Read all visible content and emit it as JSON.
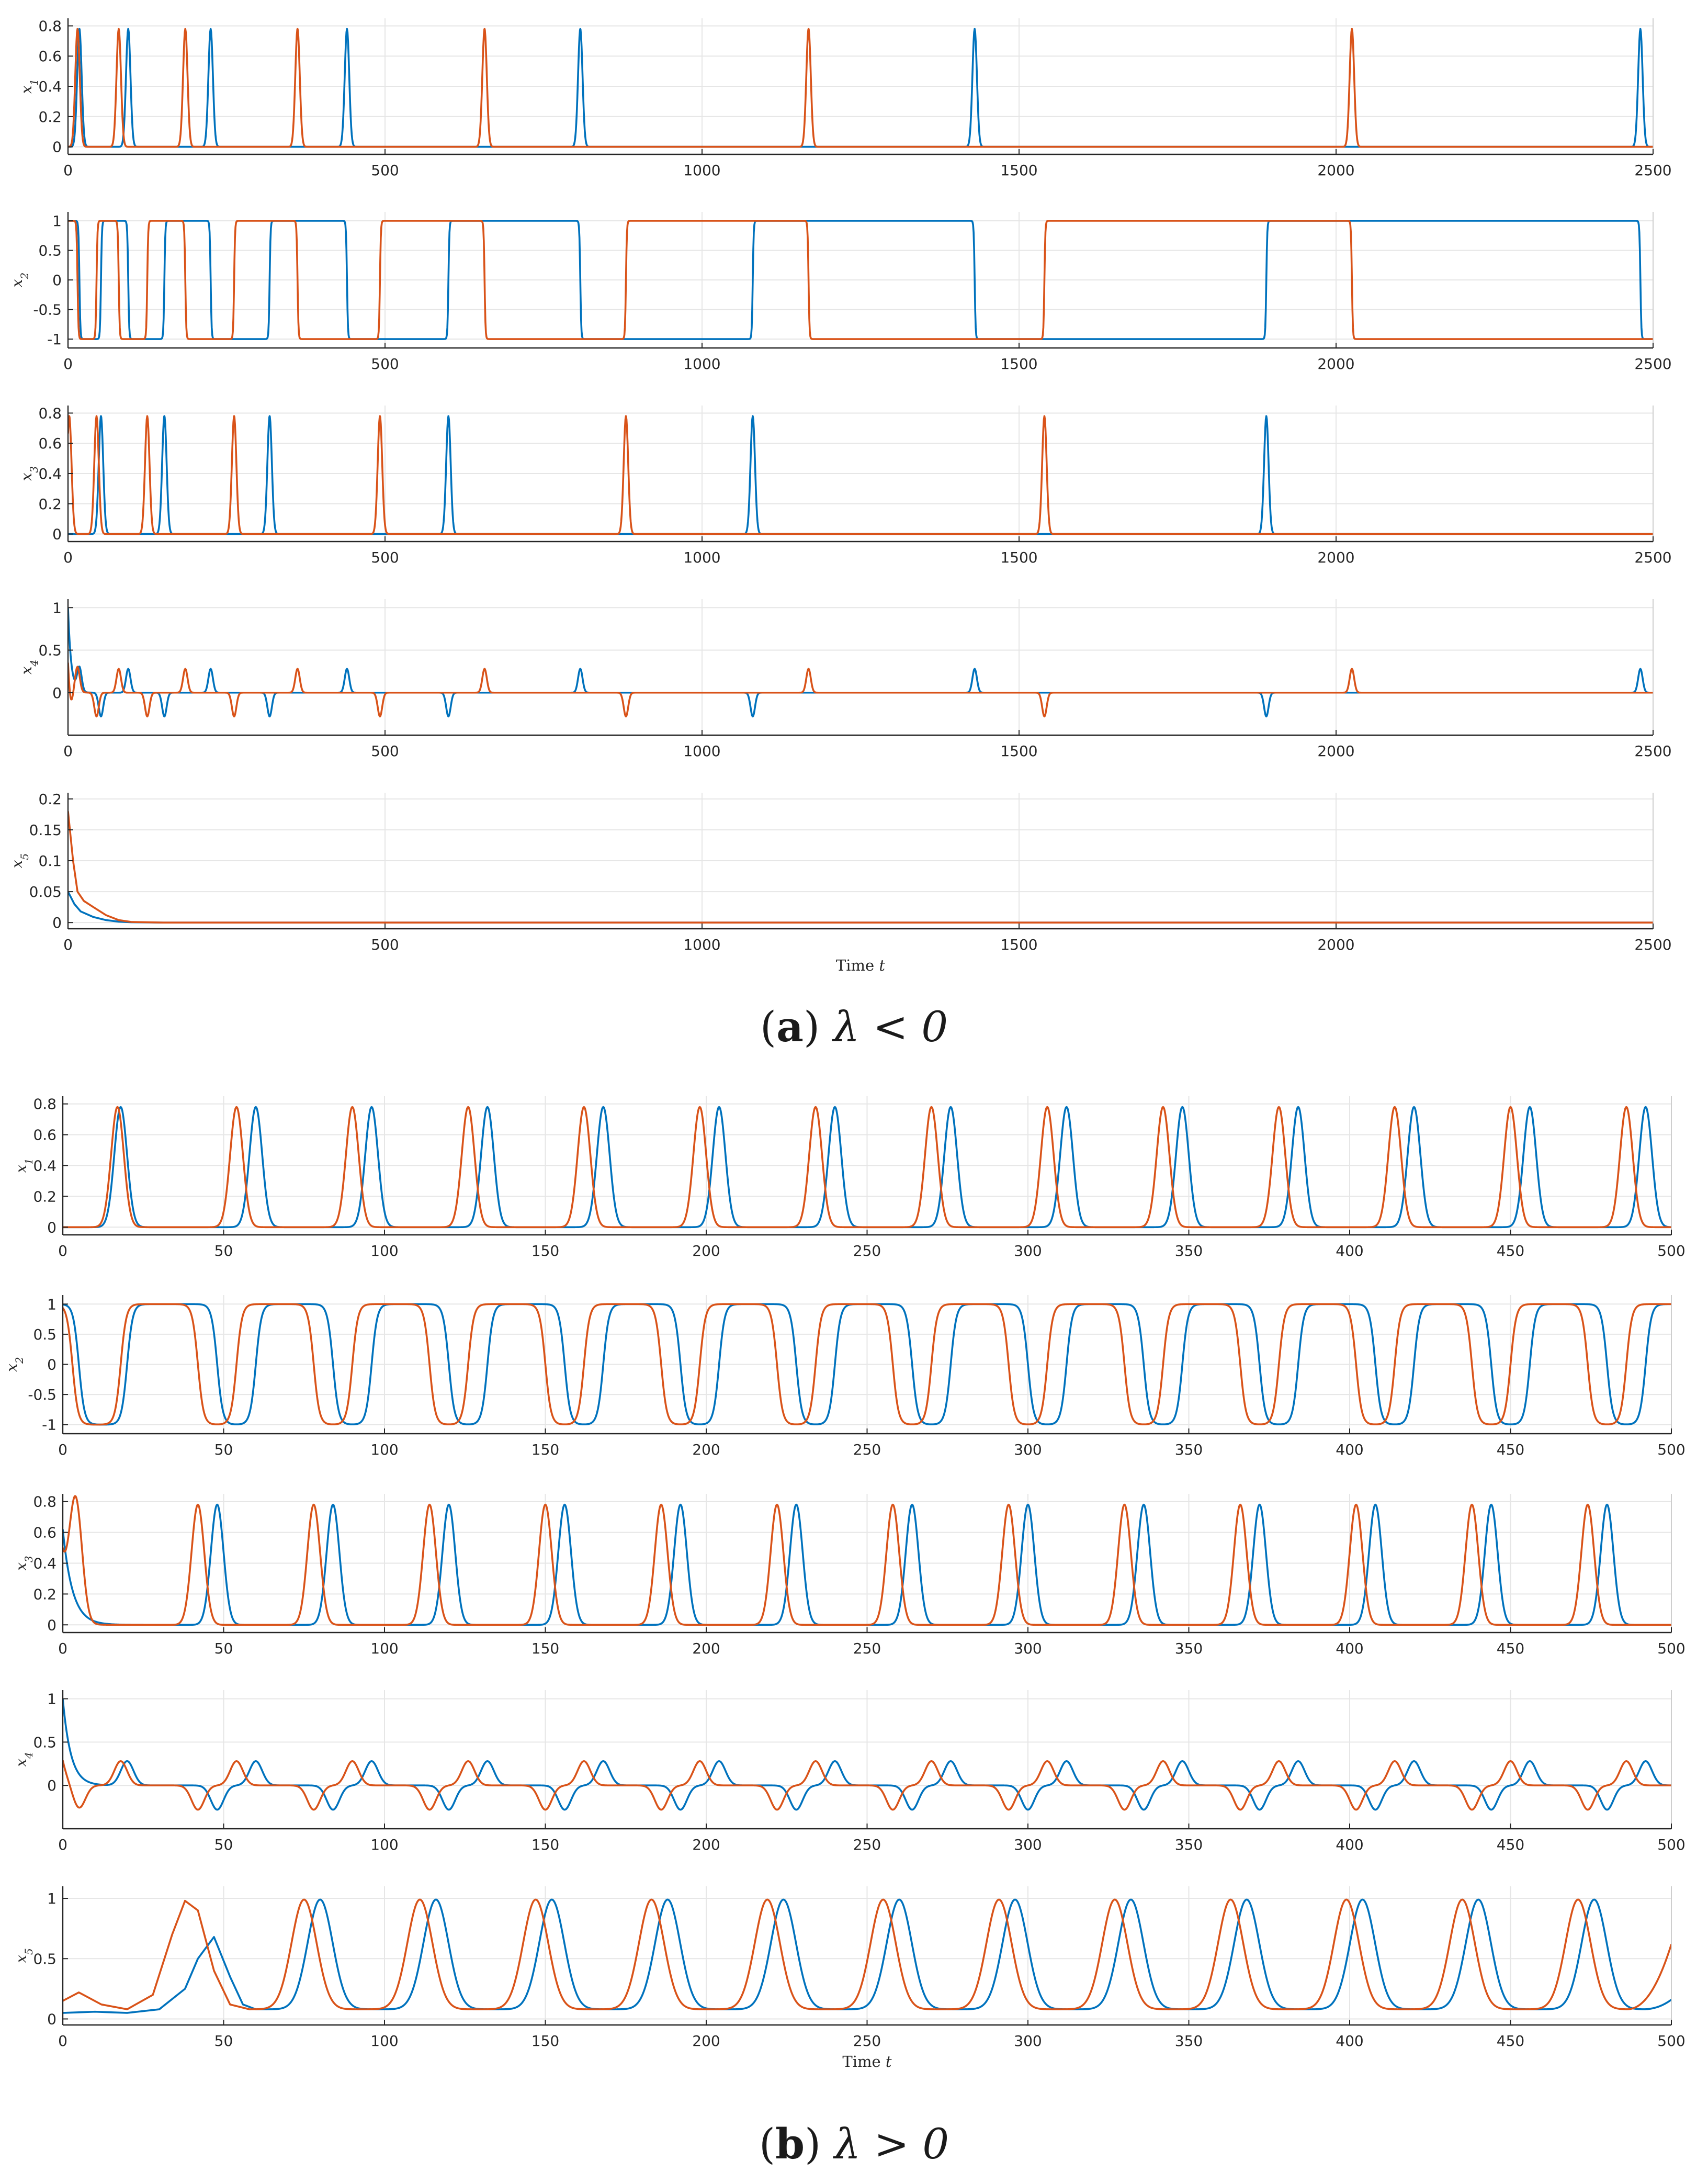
{
  "panels": [
    {
      "caption": {
        "tag_open": "(",
        "tag_letter": "a",
        "tag_close": ")",
        "condition": "λ < 0"
      },
      "x_axis_title": "Time t"
    },
    {
      "caption": {
        "tag_open": "(",
        "tag_letter": "b",
        "tag_close": ")",
        "condition": "λ > 0"
      },
      "x_axis_title": "Time t"
    }
  ],
  "colors": {
    "blue": "#0072BD",
    "orange": "#D95319",
    "grid": "#e6e6e6",
    "axis": "#262626"
  },
  "chart_data": [
    {
      "type": "line",
      "panel": "a",
      "ylabel": "x1",
      "xlim": [
        0,
        2500
      ],
      "ylim": [
        -0.05,
        0.85
      ],
      "xticks": [
        "0",
        "500",
        "1000",
        "1500",
        "2000",
        "2500"
      ],
      "yticks": [
        "0",
        "0.2",
        "0.4",
        "0.6",
        "0.8"
      ],
      "ytick_values": [
        0,
        0.2,
        0.4,
        0.6,
        0.8
      ],
      "series": [
        {
          "color": "blue",
          "baseline": 0,
          "spikes": {
            "times": [
              18,
              95,
              225,
              440,
              808,
              1430,
              2480
            ],
            "height": 0.78,
            "width": 5
          }
        },
        {
          "color": "orange",
          "baseline": 0,
          "spikes": {
            "times": [
              15,
              80,
              185,
              362,
              657,
              1168,
              2025
            ],
            "height": 0.78,
            "width": 5
          }
        }
      ]
    },
    {
      "type": "line",
      "panel": "a",
      "ylabel": "x2",
      "xlim": [
        0,
        2500
      ],
      "ylim": [
        -1.15,
        1.15
      ],
      "xticks": [
        "0",
        "500",
        "1000",
        "1500",
        "2000",
        "2500"
      ],
      "yticks": [
        "-1",
        "-0.5",
        "0",
        "0.5",
        "1"
      ],
      "ytick_values": [
        -1,
        -0.5,
        0,
        0.5,
        1
      ],
      "series": [
        {
          "color": "blue",
          "square": {
            "start": 1,
            "switches": [
              18,
              52,
              95,
              152,
              225,
              318,
              440,
              600,
              808,
              1080,
              1430,
              1890,
              2480
            ],
            "amplitude": 1,
            "edge": 3
          }
        },
        {
          "color": "orange",
          "square": {
            "start": 1,
            "switches": [
              15,
              45,
              80,
              125,
              185,
              262,
              362,
              492,
              657,
              880,
              1168,
              1540,
              2025
            ],
            "amplitude": 1,
            "edge": 3
          }
        }
      ]
    },
    {
      "type": "line",
      "panel": "a",
      "ylabel": "x3",
      "xlim": [
        0,
        2500
      ],
      "ylim": [
        -0.05,
        0.85
      ],
      "xticks": [
        "0",
        "500",
        "1000",
        "1500",
        "2000",
        "2500"
      ],
      "yticks": [
        "0",
        "0.2",
        "0.4",
        "0.6",
        "0.8"
      ],
      "ytick_values": [
        0,
        0.2,
        0.4,
        0.6,
        0.8
      ],
      "series": [
        {
          "color": "blue",
          "baseline": 0,
          "spikes": {
            "times": [
              52,
              152,
              318,
              600,
              1080,
              1890
            ],
            "height": 0.78,
            "width": 5
          }
        },
        {
          "color": "orange",
          "baseline": 0,
          "spikes": {
            "times": [
              2,
              45,
              125,
              262,
              492,
              880,
              1540
            ],
            "height": 0.78,
            "width": 5
          }
        }
      ]
    },
    {
      "type": "line",
      "panel": "a",
      "ylabel": "x4",
      "xlim": [
        0,
        2500
      ],
      "ylim": [
        -0.5,
        1.1
      ],
      "xticks": [
        "0",
        "500",
        "1000",
        "1500",
        "2000",
        "2500"
      ],
      "yticks": [
        "0",
        "0.5",
        "1"
      ],
      "ytick_values": [
        0,
        0.5,
        1
      ],
      "series": [
        {
          "color": "blue",
          "baseline": 0,
          "start": {
            "value": 1.0,
            "tau": 5
          },
          "spikes": {
            "times": [
              18,
              95,
              225,
              440,
              808,
              1430,
              2480,
              52,
              152,
              318,
              600,
              1080,
              1890
            ],
            "heights": [
              0.28,
              0.28,
              0.28,
              0.28,
              0.28,
              0.28,
              0.28,
              -0.28,
              -0.28,
              -0.28,
              -0.28,
              -0.28,
              -0.28
            ],
            "width": 5
          }
        },
        {
          "color": "orange",
          "baseline": 0,
          "start": {
            "value": 0.5,
            "tau": 5
          },
          "spikes": {
            "times": [
              15,
              80,
              185,
              362,
              657,
              1168,
              2025,
              4,
              45,
              125,
              262,
              492,
              880,
              1540
            ],
            "heights": [
              0.28,
              0.28,
              0.28,
              0.28,
              0.28,
              0.28,
              0.28,
              -0.28,
              -0.28,
              -0.28,
              -0.28,
              -0.28,
              -0.28,
              -0.28
            ],
            "width": 5
          }
        }
      ]
    },
    {
      "type": "line",
      "panel": "a",
      "ylabel": "x5",
      "xlabel": "Time t",
      "xlim": [
        0,
        2500
      ],
      "ylim": [
        -0.01,
        0.21
      ],
      "xticks": [
        "0",
        "500",
        "1000",
        "1500",
        "2000",
        "2500"
      ],
      "yticks": [
        "0",
        "0.05",
        "0.1",
        "0.15",
        "0.2"
      ],
      "ytick_values": [
        0,
        0.05,
        0.1,
        0.15,
        0.2
      ],
      "series": [
        {
          "color": "blue",
          "points": [
            [
              0,
              0.05
            ],
            [
              10,
              0.03
            ],
            [
              20,
              0.018
            ],
            [
              40,
              0.009
            ],
            [
              60,
              0.004
            ],
            [
              80,
              0.0015
            ],
            [
              100,
              0.0005
            ],
            [
              150,
              0
            ],
            [
              2500,
              0
            ]
          ]
        },
        {
          "color": "orange",
          "points": [
            [
              0,
              0.18
            ],
            [
              8,
              0.1
            ],
            [
              15,
              0.05
            ],
            [
              25,
              0.035
            ],
            [
              40,
              0.025
            ],
            [
              60,
              0.012
            ],
            [
              80,
              0.004
            ],
            [
              100,
              0.001
            ],
            [
              150,
              0
            ],
            [
              2500,
              0
            ]
          ]
        }
      ]
    },
    {
      "type": "line",
      "panel": "b",
      "ylabel": "x1",
      "xlim": [
        0,
        500
      ],
      "ylim": [
        -0.05,
        0.85
      ],
      "xticks": [
        "0",
        "50",
        "100",
        "150",
        "200",
        "250",
        "300",
        "350",
        "400",
        "450",
        "500"
      ],
      "yticks": [
        "0",
        "0.2",
        "0.4",
        "0.6",
        "0.8"
      ],
      "ytick_values": [
        0,
        0.2,
        0.4,
        0.6,
        0.8
      ],
      "series": [
        {
          "color": "blue",
          "baseline": 0,
          "spikes": {
            "times": [
              18,
              60,
              96,
              132,
              168,
              204,
              240,
              276,
              312,
              348,
              384,
              420,
              456,
              492
            ],
            "height": 0.78,
            "width": 2.8
          }
        },
        {
          "color": "orange",
          "baseline": 0,
          "spikes": {
            "times": [
              17,
              54,
              90,
              126,
              162,
              198,
              234,
              270,
              306,
              342,
              378,
              414,
              450,
              486
            ],
            "height": 0.78,
            "width": 2.8
          }
        }
      ]
    },
    {
      "type": "line",
      "panel": "b",
      "ylabel": "x2",
      "xlim": [
        0,
        500
      ],
      "ylim": [
        -1.15,
        1.15
      ],
      "xticks": [
        "0",
        "50",
        "100",
        "150",
        "200",
        "250",
        "300",
        "350",
        "400",
        "450",
        "500"
      ],
      "yticks": [
        "-1",
        "-0.5",
        "0",
        "0.5",
        "1"
      ],
      "ytick_values": [
        -1,
        -0.5,
        0,
        0.5,
        1
      ],
      "series": [
        {
          "color": "blue",
          "square": {
            "start": 1,
            "switches": [
              5,
              20,
              48,
              60,
              84,
              96,
              120,
              132,
              156,
              168,
              192,
              204,
              228,
              240,
              264,
              276,
              300,
              312,
              336,
              348,
              372,
              384,
              408,
              420,
              444,
              456,
              480,
              492
            ],
            "amplitude": 1,
            "edge": 3.5
          }
        },
        {
          "color": "orange",
          "square": {
            "start": 1,
            "switches": [
              3,
              18,
              42,
              54,
              78,
              90,
              114,
              126,
              150,
              162,
              186,
              198,
              222,
              234,
              258,
              270,
              294,
              306,
              330,
              342,
              366,
              378,
              402,
              414,
              438,
              450,
              474,
              486
            ],
            "amplitude": 1,
            "edge": 3.5
          }
        }
      ]
    },
    {
      "type": "line",
      "panel": "b",
      "ylabel": "x3",
      "xlim": [
        0,
        500
      ],
      "ylim": [
        -0.05,
        0.85
      ],
      "xticks": [
        "0",
        "50",
        "100",
        "150",
        "200",
        "250",
        "300",
        "350",
        "400",
        "450",
        "500"
      ],
      "yticks": [
        "0",
        "0.2",
        "0.4",
        "0.6",
        "0.8"
      ],
      "ytick_values": [
        0,
        0.2,
        0.4,
        0.6,
        0.8
      ],
      "series": [
        {
          "color": "blue",
          "baseline": 0,
          "start": {
            "value": 0.62,
            "tau": 3
          },
          "spikes": {
            "times": [
              48,
              84,
              120,
              156,
              192,
              228,
              264,
              300,
              336,
              372,
              408,
              444,
              480
            ],
            "height": 0.78,
            "width": 2.8
          }
        },
        {
          "color": "orange",
          "baseline": 0,
          "start": {
            "value": 0.4,
            "tau": 2
          },
          "spikes": {
            "times": [
              4,
              42,
              78,
              114,
              150,
              186,
              222,
              258,
              294,
              330,
              366,
              402,
              438,
              474
            ],
            "height": 0.78,
            "width": 2.8
          }
        }
      ]
    },
    {
      "type": "line",
      "panel": "b",
      "ylabel": "x4",
      "xlim": [
        0,
        500
      ],
      "ylim": [
        -0.5,
        1.1
      ],
      "xticks": [
        "0",
        "50",
        "100",
        "150",
        "200",
        "250",
        "300",
        "350",
        "400",
        "450",
        "500"
      ],
      "yticks": [
        "0",
        "0.5",
        "1"
      ],
      "ytick_values": [
        0,
        0.5,
        1
      ],
      "series": [
        {
          "color": "blue",
          "baseline": 0,
          "start": {
            "value": 1.0,
            "tau": 2.5
          },
          "spikes": {
            "times": [
              20,
              60,
              96,
              132,
              168,
              204,
              240,
              276,
              312,
              348,
              384,
              420,
              456,
              492,
              48,
              84,
              120,
              156,
              192,
              228,
              264,
              300,
              336,
              372,
              408,
              444,
              480
            ],
            "heights": [
              0.28,
              0.28,
              0.28,
              0.28,
              0.28,
              0.28,
              0.28,
              0.28,
              0.28,
              0.28,
              0.28,
              0.28,
              0.28,
              0.28,
              -0.28,
              -0.28,
              -0.28,
              -0.28,
              -0.28,
              -0.28,
              -0.28,
              -0.28,
              -0.28,
              -0.28,
              -0.28,
              -0.28,
              -0.28
            ],
            "width": 2.8
          }
        },
        {
          "color": "orange",
          "baseline": 0,
          "start": {
            "value": 0.3,
            "tau": 2
          },
          "spikes": {
            "times": [
              18,
              54,
              90,
              126,
              162,
              198,
              234,
              270,
              306,
              342,
              378,
              414,
              450,
              486,
              5,
              42,
              78,
              114,
              150,
              186,
              222,
              258,
              294,
              330,
              366,
              402,
              438,
              474
            ],
            "heights": [
              0.28,
              0.28,
              0.28,
              0.28,
              0.28,
              0.28,
              0.28,
              0.28,
              0.28,
              0.28,
              0.28,
              0.28,
              0.28,
              0.28,
              -0.28,
              -0.28,
              -0.28,
              -0.28,
              -0.28,
              -0.28,
              -0.28,
              -0.28,
              -0.28,
              -0.28,
              -0.28,
              -0.28,
              -0.28,
              -0.28
            ],
            "width": 2.8
          }
        }
      ]
    },
    {
      "type": "line",
      "panel": "b",
      "ylabel": "x5",
      "xlabel": "Time t",
      "xlim": [
        0,
        500
      ],
      "ylim": [
        -0.05,
        1.1
      ],
      "xticks": [
        "0",
        "50",
        "100",
        "150",
        "200",
        "250",
        "300",
        "350",
        "400",
        "450",
        "500"
      ],
      "yticks": [
        "0",
        "0.5",
        "1"
      ],
      "ytick_values": [
        0,
        0.5,
        1
      ],
      "series": [
        {
          "color": "blue",
          "points": [
            [
              0,
              0.05
            ],
            [
              10,
              0.06
            ],
            [
              20,
              0.05
            ],
            [
              30,
              0.08
            ],
            [
              38,
              0.25
            ],
            [
              42,
              0.5
            ],
            [
              47,
              0.68
            ],
            [
              52,
              0.35
            ],
            [
              56,
              0.12
            ],
            [
              60,
              0.08
            ]
          ],
          "pulses": {
            "times": [
              80,
              116,
              152,
              188,
              224,
              260,
              296,
              332,
              368,
              404,
              440,
              476
            ],
            "peak": 0.99,
            "base": 0.08,
            "width": 5.5
          },
          "tail_end": 500,
          "tail_value": 0.16
        },
        {
          "color": "orange",
          "points": [
            [
              0,
              0.15
            ],
            [
              5,
              0.22
            ],
            [
              12,
              0.12
            ],
            [
              20,
              0.08
            ],
            [
              28,
              0.2
            ],
            [
              34,
              0.7
            ],
            [
              38,
              0.98
            ],
            [
              42,
              0.9
            ],
            [
              47,
              0.4
            ],
            [
              52,
              0.12
            ],
            [
              58,
              0.08
            ]
          ],
          "pulses": {
            "times": [
              75,
              111,
              147,
              183,
              219,
              255,
              291,
              327,
              363,
              399,
              435,
              471
            ],
            "peak": 0.99,
            "base": 0.08,
            "width": 5.5
          },
          "tail_end": 500,
          "tail_value": 0.62
        }
      ]
    }
  ]
}
